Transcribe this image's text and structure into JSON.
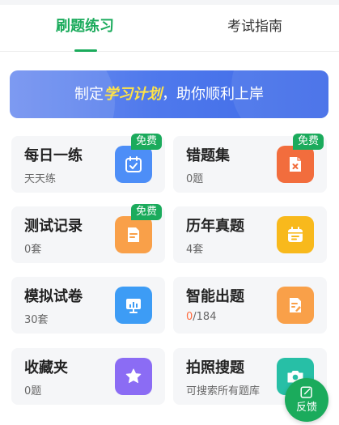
{
  "tabs": [
    {
      "label": "刷题练习",
      "active": true
    },
    {
      "label": "考试指南",
      "active": false
    }
  ],
  "banner": {
    "prefix": "制定",
    "highlight": "学习计划",
    "suffix": "，助你顺利上岸"
  },
  "cards": [
    {
      "title": "每日一练",
      "subtitle": "天天练",
      "badge": "免费",
      "icon": "calendar-check-icon",
      "icon_color": "#4d8ef7"
    },
    {
      "title": "错题集",
      "subtitle": "0题",
      "badge": "免费",
      "icon": "wrong-doc-icon",
      "icon_color": "#f26d3d"
    },
    {
      "title": "测试记录",
      "subtitle": "0套",
      "badge": "免费",
      "icon": "document-icon",
      "icon_color": "#f9a049"
    },
    {
      "title": "历年真题",
      "subtitle": "4套",
      "icon": "calendar-icon",
      "icon_color": "#f8b91c"
    },
    {
      "title": "模拟试卷",
      "subtitle": "30套",
      "icon": "presentation-chart-icon",
      "icon_color": "#3d9cf5"
    },
    {
      "title": "智能出题",
      "progress_done": "0",
      "progress_total": "/184",
      "icon": "edit-doc-icon",
      "icon_color": "#f9a049"
    },
    {
      "title": "收藏夹",
      "subtitle": "0题",
      "icon": "star-icon",
      "icon_color": "#8b6cf4"
    },
    {
      "title": "拍照搜题",
      "subtitle": "可搜索所有题库",
      "icon": "camera-icon",
      "icon_color": "#27bfa6"
    }
  ],
  "feedback": {
    "label": "反馈",
    "icon": "edit-icon"
  },
  "colors": {
    "brand_green": "#1bab5c",
    "banner_blue": "#4f79ec",
    "highlight_yellow": "#ffe347",
    "progress_orange": "#ff6a3d"
  }
}
